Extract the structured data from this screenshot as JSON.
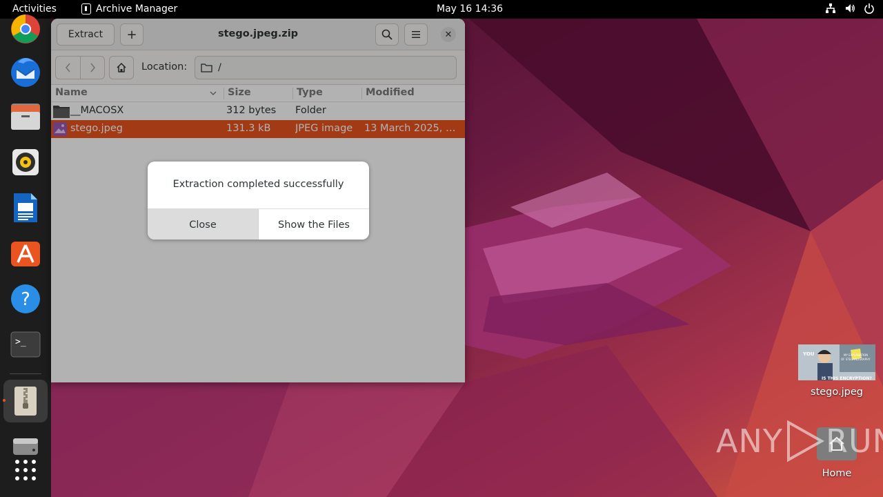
{
  "topbar": {
    "activities": "Activities",
    "app_name": "Archive Manager",
    "clock": "May 16  14:36",
    "tray_icons": [
      "network-icon",
      "volume-icon",
      "power-icon"
    ]
  },
  "dock": {
    "items": [
      "chrome",
      "thunderbird",
      "files",
      "rhythmbox",
      "libreoffice-writer",
      "app-center",
      "help",
      "terminal",
      "archive-manager",
      "disk",
      "app-grid"
    ],
    "accent_color": "#e95420"
  },
  "window": {
    "title": "stego.jpeg.zip",
    "extract_label": "Extract",
    "add_label": "+",
    "close_glyph": "✕",
    "location_label": "Location:",
    "location_value": "/",
    "columns": {
      "name": "Name",
      "size": "Size",
      "type": "Type",
      "modified": "Modified"
    },
    "rows": [
      {
        "name": "__MACOSX",
        "size": "312 bytes",
        "type": "Folder",
        "modified": ""
      },
      {
        "name": "stego.jpeg",
        "size": "131.3 kB",
        "type": "JPEG image",
        "modified": "13 March 2025, …"
      }
    ]
  },
  "dialog": {
    "message": "Extraction completed successfully",
    "close_label": "Close",
    "show_label": "Show the Files"
  },
  "desktop": {
    "file_icon_label": "stego.jpeg",
    "home_label": "Home"
  },
  "watermark": {
    "left": "ANY",
    "right": "RUN"
  }
}
